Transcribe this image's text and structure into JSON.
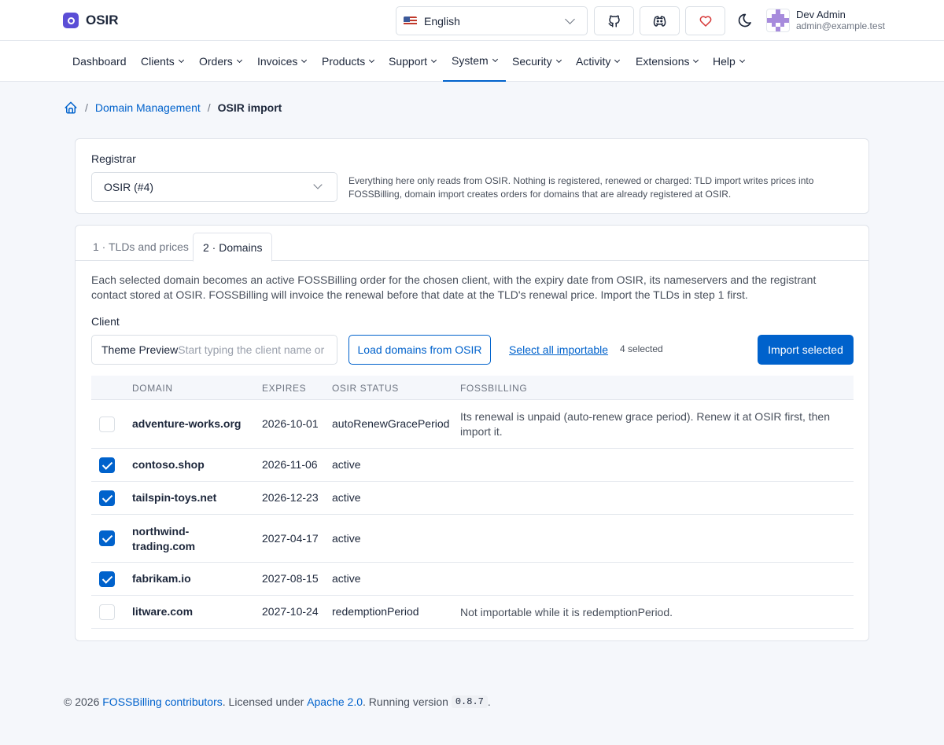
{
  "app": {
    "name": "OSIR"
  },
  "header": {
    "language": "English",
    "user": {
      "name": "Dev Admin",
      "email": "admin@example.test"
    },
    "icons": [
      "github-icon",
      "discord-icon",
      "heart-icon",
      "moon-icon"
    ]
  },
  "nav": {
    "items": [
      "Dashboard",
      "Clients",
      "Orders",
      "Invoices",
      "Products",
      "Support",
      "System",
      "Security",
      "Activity",
      "Extensions",
      "Help"
    ],
    "active": "System"
  },
  "breadcrumb": {
    "parent": "Domain Management",
    "current": "OSIR import"
  },
  "registrar": {
    "label": "Registrar",
    "value": "OSIR (#4)",
    "hint": "Everything here only reads from OSIR. Nothing is registered, renewed or charged: TLD import writes prices into FOSSBilling, domain import creates orders for domains that are already registered at OSIR."
  },
  "tabs": {
    "tab1": "1 · TLDs and prices",
    "tab2": "2 · Domains",
    "active": "2 · Domains"
  },
  "domains_step": {
    "description": "Each selected domain becomes an active FOSSBilling order for the chosen client, with the expiry date from OSIR, its nameservers and the registrant contact stored at OSIR. FOSSBilling will invoice the renewal before that date at the TLD's renewal price. Import the TLDs in step 1 first.",
    "client_label": "Client",
    "client_value": "Theme Preview",
    "client_placeholder": "Start typing the client name or",
    "load_button": "Load domains from OSIR",
    "select_all": "Select all importable",
    "selected_count": "4 selected",
    "import_button": "Import selected"
  },
  "table": {
    "headers": {
      "domain": "DOMAIN",
      "expires": "EXPIRES",
      "status": "OSIR STATUS",
      "fossbilling": "FOSSBILLING"
    },
    "rows": [
      {
        "checked": false,
        "domain": "adventure-works.org",
        "expires": "2026-10-01",
        "status": "autoRenewGracePeriod",
        "note": "Its renewal is unpaid (auto-renew grace period). Renew it at OSIR first, then import it."
      },
      {
        "checked": true,
        "domain": "contoso.shop",
        "expires": "2026-11-06",
        "status": "active",
        "note": ""
      },
      {
        "checked": true,
        "domain": "tailspin-toys.net",
        "expires": "2026-12-23",
        "status": "active",
        "note": ""
      },
      {
        "checked": true,
        "domain": "northwind-trading.com",
        "expires": "2027-04-17",
        "status": "active",
        "note": ""
      },
      {
        "checked": true,
        "domain": "fabrikam.io",
        "expires": "2027-08-15",
        "status": "active",
        "note": ""
      },
      {
        "checked": false,
        "domain": "litware.com",
        "expires": "2027-10-24",
        "status": "redemptionPeriod",
        "note": "Not importable while it is redemptionPeriod."
      }
    ]
  },
  "footer": {
    "prefix": "© 2026 ",
    "contributors": "FOSSBilling contributors",
    "mid": ". Licensed under ",
    "license": "Apache 2.0",
    "running": ". Running version ",
    "version": "0.8.7",
    "end": "."
  },
  "colors": {
    "accent": "#0062cc",
    "brand": "#5b4ed6",
    "heart": "#d63939"
  }
}
